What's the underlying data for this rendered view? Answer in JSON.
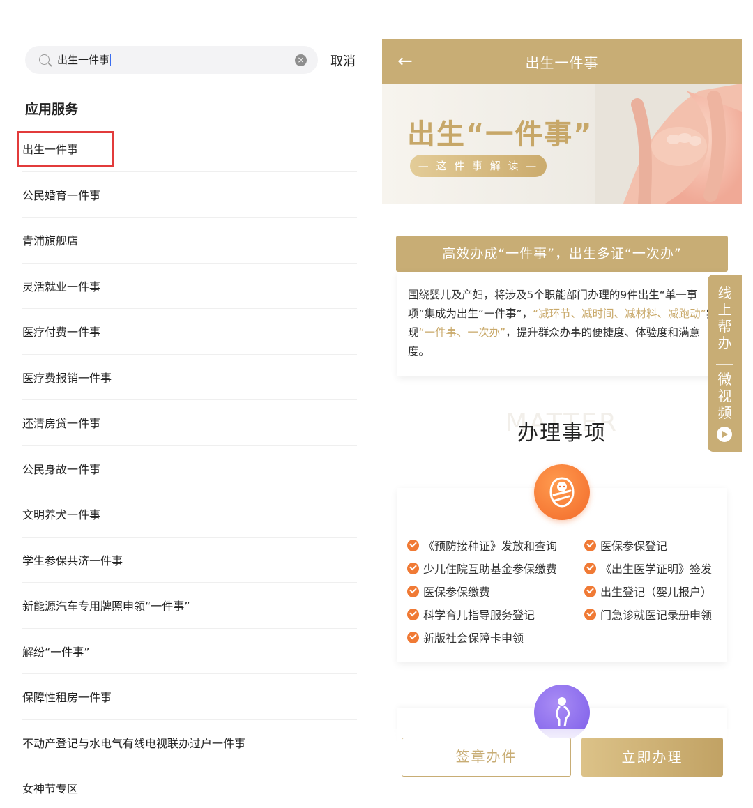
{
  "left": {
    "search": {
      "value": "出生一件事"
    },
    "cancel_label": "取消",
    "section_title": "应用服务",
    "results": [
      "出生一件事",
      "公民婚育一件事",
      "青浦旗舰店",
      "灵活就业一件事",
      "医疗付费一件事",
      "医疗费报销一件事",
      "还清房贷一件事",
      "公民身故一件事",
      "文明养犬一件事",
      "学生参保共济一件事",
      "新能源汽车专用牌照申领“一件事”",
      "解纷“一件事”",
      "保障性租房一件事",
      "不动产登记与水电气有线电视联办过户一件事",
      "女神节专区"
    ]
  },
  "right": {
    "topbar_title": "出生一件事",
    "banner": {
      "title": "出生“一件事”",
      "pill": "— 这 件 事 解 读 —"
    },
    "headline": "高效办成“一件事”，出生多证“一次办”",
    "intro": {
      "part1": "围绕婴儿及产妇，将涉及5个职能部门办理的9件出生“单一事项”集成为出生“一件事”，",
      "gold1": "“减环节、减时间、减材料、减跑动”",
      "part2": "实现",
      "gold2": "“一件事、一次办”",
      "part3": "，提升群众办事的便捷度、体验度和满意度。"
    },
    "side_float": {
      "top": [
        "线",
        "上",
        "帮",
        "办"
      ],
      "bottom": [
        "微",
        "视",
        "频"
      ]
    },
    "matter_bg": "MATTER",
    "matter_title": "办理事项",
    "items": [
      "《预防接种证》发放和查询",
      "医保参保登记",
      "少儿住院互助基金参保缴费",
      "《出生医学证明》签发",
      "医保参保缴费",
      "出生登记（婴儿报户）",
      "科学育儿指导服务登记",
      "门急诊就医记录册申领",
      "新版社会保障卡申领"
    ],
    "buttons": {
      "sign": "签章办件",
      "now": "立即办理"
    },
    "colors": {
      "gold": "#c8ad75",
      "orange": "#f07a35",
      "purple": "#7b5ce8",
      "highlight_red": "#e23b3b"
    }
  }
}
